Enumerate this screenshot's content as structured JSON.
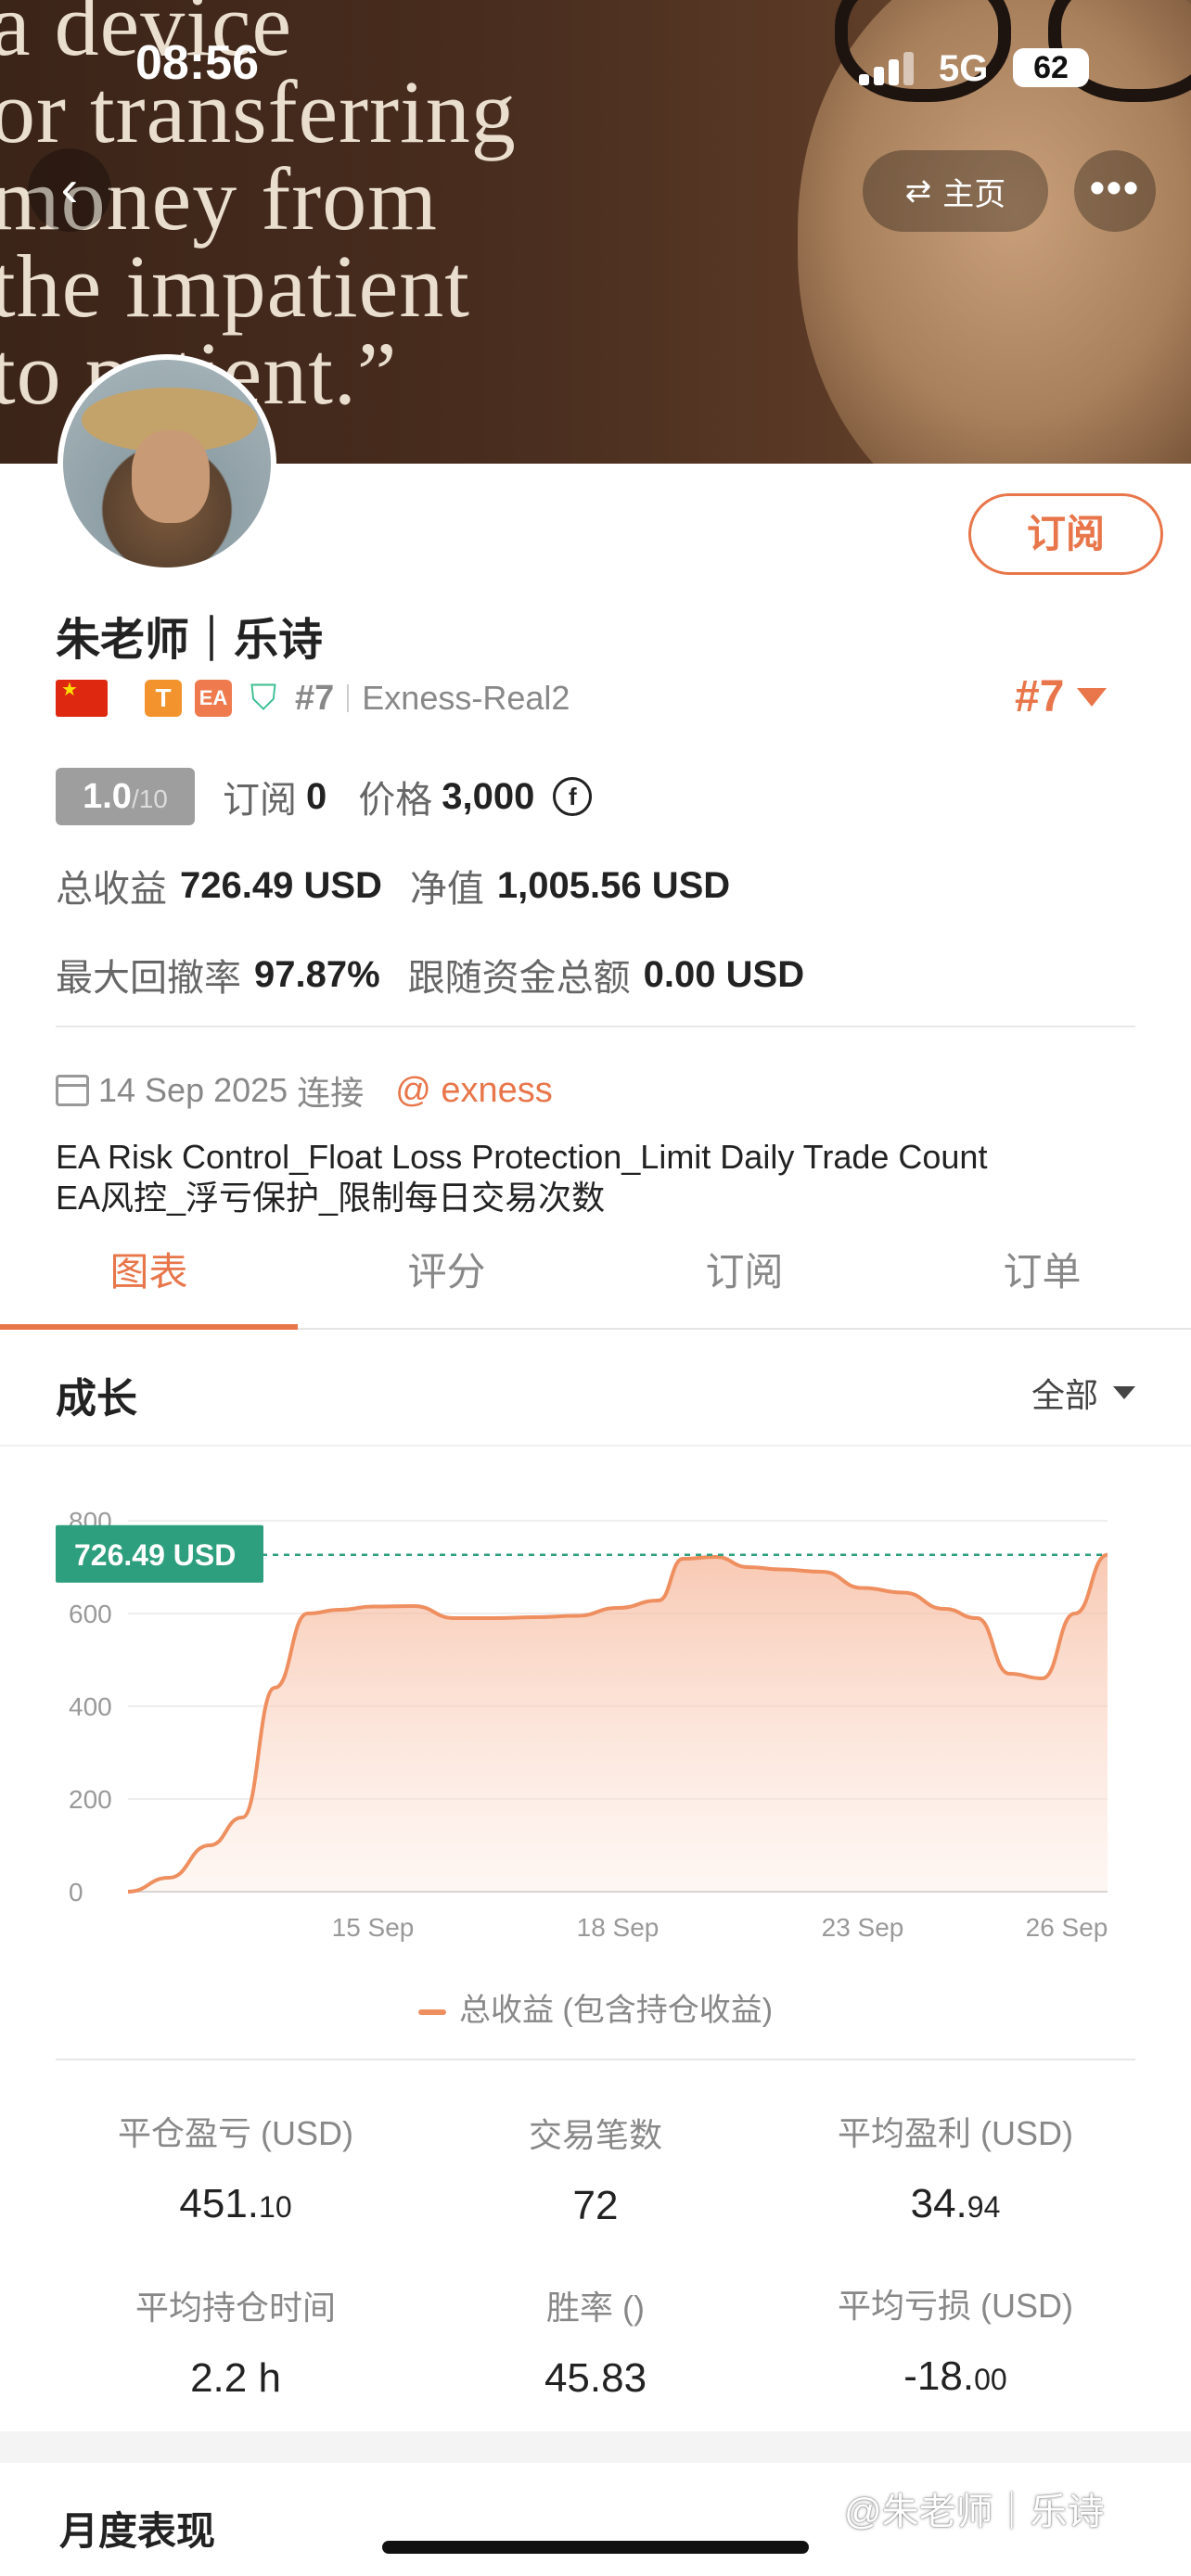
{
  "status_bar": {
    "time": "08:56",
    "network": "5G",
    "battery": "62"
  },
  "cover": {
    "quote_lines": [
      "a device",
      "or transferring",
      "money from",
      "the impatient",
      "to patient.”"
    ]
  },
  "header": {
    "back_icon": "chevron-left-icon",
    "home_label": "主页",
    "home_icon": "swap-arrows-icon",
    "more_icon": "more-dots-icon"
  },
  "profile": {
    "name": "朱老师｜乐诗",
    "subscribe_label": "订阅",
    "badge_t": "T",
    "badge_ea": "EA",
    "rank_small": "#7",
    "account": "Exness-Real2",
    "rank_big": "#7"
  },
  "summary": {
    "rating": "1.0",
    "rating_max": "/10",
    "subscribe_label": "订阅",
    "subscribe_count": "0",
    "price_label": "价格",
    "price_value": "3,000",
    "coin_symbol": "f"
  },
  "metrics": {
    "total_profit_label": "总收益",
    "total_profit_value": "726.49 USD",
    "equity_label": "净值",
    "equity_value": "1,005.56 USD",
    "max_drawdown_label": "最大回撤率",
    "max_drawdown_value": "97.87%",
    "follow_funds_label": "跟随资金总额",
    "follow_funds_value": "0.00 USD"
  },
  "connection": {
    "date": "14 Sep 2025",
    "label": "连接",
    "broker": "@ exness"
  },
  "description": {
    "en": "EA Risk Control_Float Loss Protection_Limit Daily Trade Count",
    "zh": "EA风控_浮亏保护_限制每日交易次数"
  },
  "tabs": [
    {
      "label": "图表",
      "active": true
    },
    {
      "label": "评分",
      "active": false
    },
    {
      "label": "订阅",
      "active": false
    },
    {
      "label": "订单",
      "active": false
    }
  ],
  "growth": {
    "title": "成长",
    "filter": "全部"
  },
  "chart_data": {
    "type": "area",
    "y_ticks": [
      "800",
      "600",
      "400",
      "200",
      "0"
    ],
    "ylim": [
      0,
      800
    ],
    "x_ticks": [
      "15 Sep",
      "18 Sep",
      "23 Sep",
      "26 Sep"
    ],
    "x_tick_positions": [
      3.0,
      6.0,
      9.0,
      11.5
    ],
    "xlim": [
      0,
      12
    ],
    "current_label": "726.49 USD",
    "current_value": 726.49,
    "series": [
      {
        "name": "总收益 (包含持仓收益)",
        "x": [
          0.0,
          0.5,
          1.0,
          1.4,
          1.8,
          2.2,
          2.6,
          3.0,
          3.5,
          4.0,
          4.5,
          5.0,
          5.5,
          6.0,
          6.5,
          6.8,
          7.2,
          7.6,
          8.0,
          8.5,
          9.0,
          9.5,
          10.0,
          10.4,
          10.8,
          11.2,
          11.6,
          12.0
        ],
        "values": [
          0,
          30,
          100,
          160,
          440,
          600,
          608,
          615,
          616,
          590,
          590,
          592,
          595,
          612,
          628,
          718,
          722,
          700,
          695,
          690,
          655,
          645,
          610,
          590,
          470,
          460,
          600,
          726.49
        ],
        "color": "#ef8f60"
      }
    ],
    "reference_line_color": "#2e9f7e",
    "grid": true
  },
  "legend": {
    "label": "总收益 (包含持仓收益)"
  },
  "stats": [
    {
      "label": "平仓盈亏 (USD)",
      "int": "451.",
      "dec": "10",
      "color": "green"
    },
    {
      "label": "交易笔数",
      "int": "72",
      "dec": "",
      "color": "default"
    },
    {
      "label": "平均盈利 (USD)",
      "int": "34.",
      "dec": "94",
      "color": "default"
    },
    {
      "label": "平均持仓时间",
      "int": "2.2 h",
      "dec": "",
      "color": "default"
    },
    {
      "label": "胜率 ()",
      "int": "45.83",
      "dec": "",
      "color": "default"
    },
    {
      "label": "平均亏损 (USD)",
      "int": "-18.",
      "dec": "00",
      "color": "default"
    }
  ],
  "monthly": {
    "title": "月度表现"
  },
  "watermark": "@朱老师｜乐诗"
}
